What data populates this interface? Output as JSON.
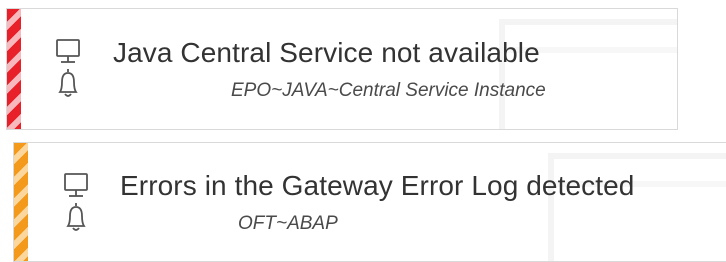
{
  "alerts": [
    {
      "title": "Java Central Service not available",
      "subtitle": "EPO~JAVA~Central Service Instance",
      "severity_color": "#e8202a",
      "icons": [
        "monitor-icon",
        "bell-icon"
      ]
    },
    {
      "title": "Errors in the Gateway Error Log detected",
      "subtitle": "OFT~ABAP",
      "severity_color": "#f39a1c",
      "icons": [
        "monitor-icon",
        "bell-icon"
      ]
    }
  ]
}
